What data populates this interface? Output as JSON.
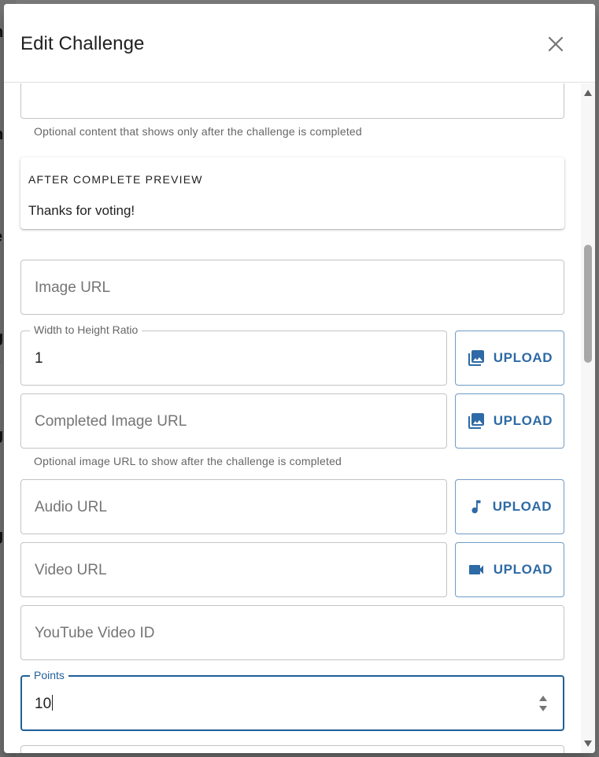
{
  "dialog": {
    "title": "Edit Challenge"
  },
  "form": {
    "after_complete_helper": "Optional content that shows only after the challenge is completed",
    "preview": {
      "heading": "AFTER COMPLETE PREVIEW",
      "text": "Thanks for voting!"
    },
    "image_url": {
      "placeholder": "Image URL",
      "value": ""
    },
    "ratio": {
      "label": "Width to Height Ratio",
      "value": "1"
    },
    "completed_image_url": {
      "placeholder": "Completed Image URL",
      "value": ""
    },
    "completed_image_helper": "Optional image URL to show after the challenge is completed",
    "audio_url": {
      "placeholder": "Audio URL",
      "value": ""
    },
    "video_url": {
      "placeholder": "Video URL",
      "value": ""
    },
    "youtube_id": {
      "placeholder": "YouTube Video ID",
      "value": ""
    },
    "points": {
      "label": "Points",
      "value": "10"
    },
    "upload_label": "UPLOAD"
  },
  "icons": {
    "close": "close-icon",
    "image_upload": "photo-library-icon",
    "audio_upload": "music-note-icon",
    "video_upload": "videocam-icon",
    "stepper": "number-stepper-icon"
  },
  "colors": {
    "accent": "#2e6aa5",
    "focus": "#1f5f99",
    "border": "#c4c4c4"
  }
}
